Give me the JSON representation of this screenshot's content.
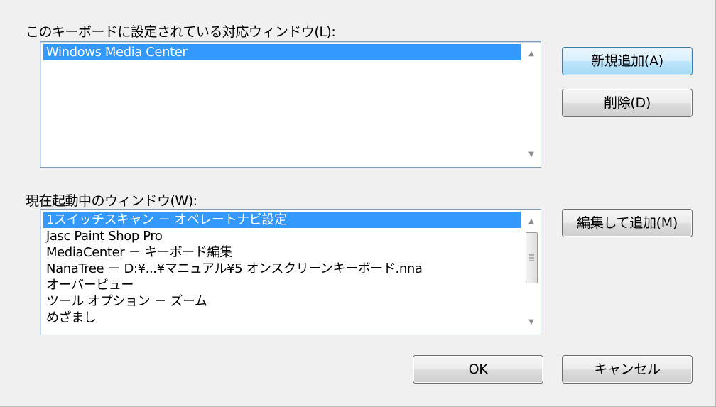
{
  "top_section": {
    "label": "このキーボードに設定されている対応ウィンドウ(L):",
    "items": [
      "Windows Media Center"
    ],
    "selected_index": 0
  },
  "bottom_section": {
    "label": "現在起動中のウィンドウ(W):",
    "items": [
      "1スイッチスキャン － オペレートナビ設定",
      "Jasc Paint Shop Pro",
      "MediaCenter － キーボード編集",
      "NanaTree － D:¥...¥マニュアル¥5 オンスクリーンキーボード.nna",
      "オーバービュー",
      "ツール オプション － ズーム",
      "めざまし"
    ],
    "selected_index": 0
  },
  "buttons": {
    "add_new": "新規追加(A)",
    "delete": "削除(D)",
    "edit_add": "編集して追加(M)",
    "ok": "OK",
    "cancel": "キャンセル"
  },
  "scroll_icons": {
    "up": "scroll-up-arrow-icon",
    "down": "scroll-down-arrow-icon"
  },
  "colors": {
    "selection": "#3399ff",
    "default_button": "#bee6fd",
    "background": "#f0f0f0"
  }
}
